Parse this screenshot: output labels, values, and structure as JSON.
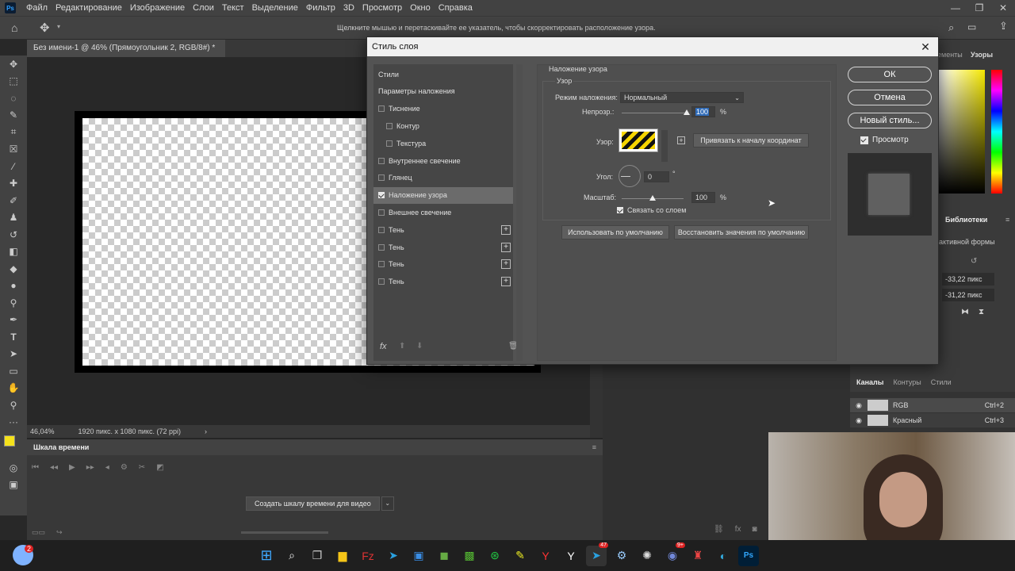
{
  "menu": [
    "Файл",
    "Редактирование",
    "Изображение",
    "Слои",
    "Текст",
    "Выделение",
    "Фильтр",
    "3D",
    "Просмотр",
    "Окно",
    "Справка"
  ],
  "options_hint": "Щелкните мышью и перетаскивайте ее указатель, чтобы скорректировать расположение узора.",
  "doc_tab": "Без имени-1 @ 46% (Прямоугольник 2, RGB/8#) *",
  "status": {
    "zoom": "46,04%",
    "size": "1920 пикс. x 1080 пикс. (72 ppi)"
  },
  "timeline": {
    "title": "Шкала времени",
    "create_button": "Создать шкалу времени для видео"
  },
  "right_panels": {
    "tab_patterns": "Узоры",
    "tab_elements": "ементы",
    "libraries": "Библиотеки",
    "shape_props": "активной формы",
    "x_val": "-33,22 пикс",
    "y_val": "-31,22 пикс",
    "tabs_bottom": [
      "Каналы",
      "Контуры",
      "Стили"
    ],
    "channels": [
      {
        "name": "RGB",
        "shortcut": "Ctrl+2"
      },
      {
        "name": "Красный",
        "shortcut": "Ctrl+3"
      }
    ]
  },
  "dialog": {
    "title": "Стиль слоя",
    "list": [
      {
        "label": "Стили",
        "checkbox": false,
        "checked": false,
        "indent": 0,
        "plus": false,
        "selected": false
      },
      {
        "label": "Параметры наложения",
        "checkbox": false,
        "checked": false,
        "indent": 0,
        "plus": false,
        "selected": false
      },
      {
        "label": "Тиснение",
        "checkbox": true,
        "checked": false,
        "indent": 0,
        "plus": false,
        "selected": false
      },
      {
        "label": "Контур",
        "checkbox": true,
        "checked": false,
        "indent": 1,
        "plus": false,
        "selected": false
      },
      {
        "label": "Текстура",
        "checkbox": true,
        "checked": false,
        "indent": 1,
        "plus": false,
        "selected": false
      },
      {
        "label": "Внутреннее свечение",
        "checkbox": true,
        "checked": false,
        "indent": 0,
        "plus": false,
        "selected": false
      },
      {
        "label": "Глянец",
        "checkbox": true,
        "checked": false,
        "indent": 0,
        "plus": false,
        "selected": false
      },
      {
        "label": "Наложение узора",
        "checkbox": true,
        "checked": true,
        "indent": 0,
        "plus": false,
        "selected": true
      },
      {
        "label": "Внешнее свечение",
        "checkbox": true,
        "checked": false,
        "indent": 0,
        "plus": false,
        "selected": false
      },
      {
        "label": "Тень",
        "checkbox": true,
        "checked": false,
        "indent": 0,
        "plus": true,
        "selected": false
      },
      {
        "label": "Тень",
        "checkbox": true,
        "checked": false,
        "indent": 0,
        "plus": true,
        "selected": false
      },
      {
        "label": "Тень",
        "checkbox": true,
        "checked": false,
        "indent": 0,
        "plus": true,
        "selected": false
      },
      {
        "label": "Тень",
        "checkbox": true,
        "checked": false,
        "indent": 0,
        "plus": true,
        "selected": false
      }
    ],
    "fx_label": "fx",
    "section_title": "Наложение узора",
    "group_title": "Узор",
    "blend_label": "Режим наложения:",
    "blend_value": "Нормальный",
    "opacity_label": "Непрозр.:",
    "opacity_value": "100",
    "opacity": 100,
    "pattern_label": "Узор:",
    "snap_button": "Привязать к началу координат",
    "angle_label": "Угол:",
    "angle_value": "0",
    "degree": "°",
    "scale_label": "Масштаб:",
    "scale_value": "100",
    "scale_pct": 100,
    "percent": "%",
    "link_label": "Связать со слоем",
    "default_button": "Использовать по умолчанию",
    "reset_button": "Восстановить значения по умолчанию",
    "ok": "ОК",
    "cancel": "Отмена",
    "new_style": "Новый стиль...",
    "preview_label": "Просмотр"
  },
  "taskbar": {
    "badge_left": "2",
    "badge_telegram": "47",
    "badge_discord": "9+"
  },
  "colors": {
    "foreground": "#f5e21b",
    "pattern_yellow": "#f5d400",
    "accent_blue": "#2fa0ff"
  }
}
